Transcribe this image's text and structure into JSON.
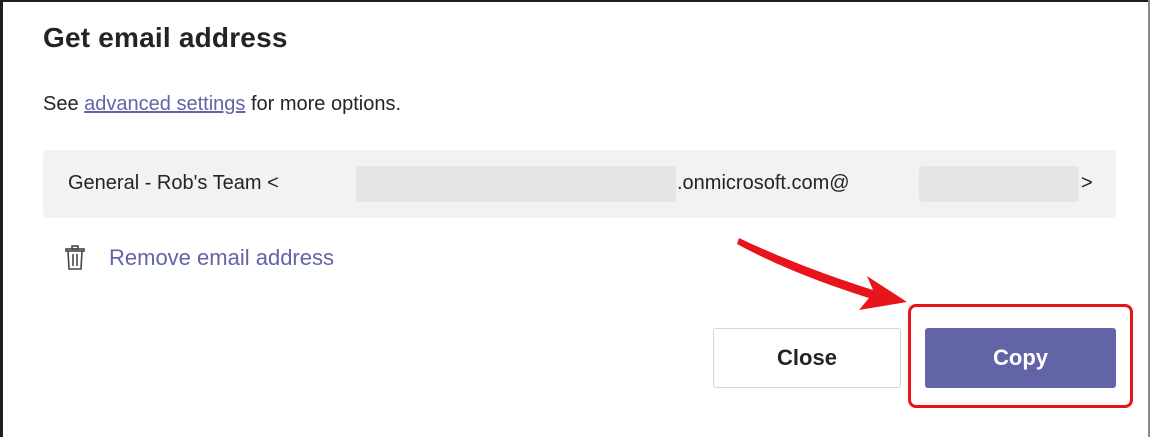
{
  "dialog": {
    "title": "Get email address",
    "description_prefix": "See ",
    "description_link": "advanced settings",
    "description_suffix": " for more options."
  },
  "email": {
    "prefix": "General - Rob's Team <",
    "domain": ".onmicrosoft.com@",
    "suffix": ">"
  },
  "remove": {
    "label": "Remove email address",
    "icon": "trash-icon"
  },
  "buttons": {
    "close_label": "Close",
    "copy_label": "Copy"
  },
  "annotation": {
    "color": "#e8141c",
    "type": "arrow-and-box"
  },
  "colors": {
    "accent": "#6264a7",
    "field_bg": "#f3f2f1",
    "text": "#252423"
  }
}
